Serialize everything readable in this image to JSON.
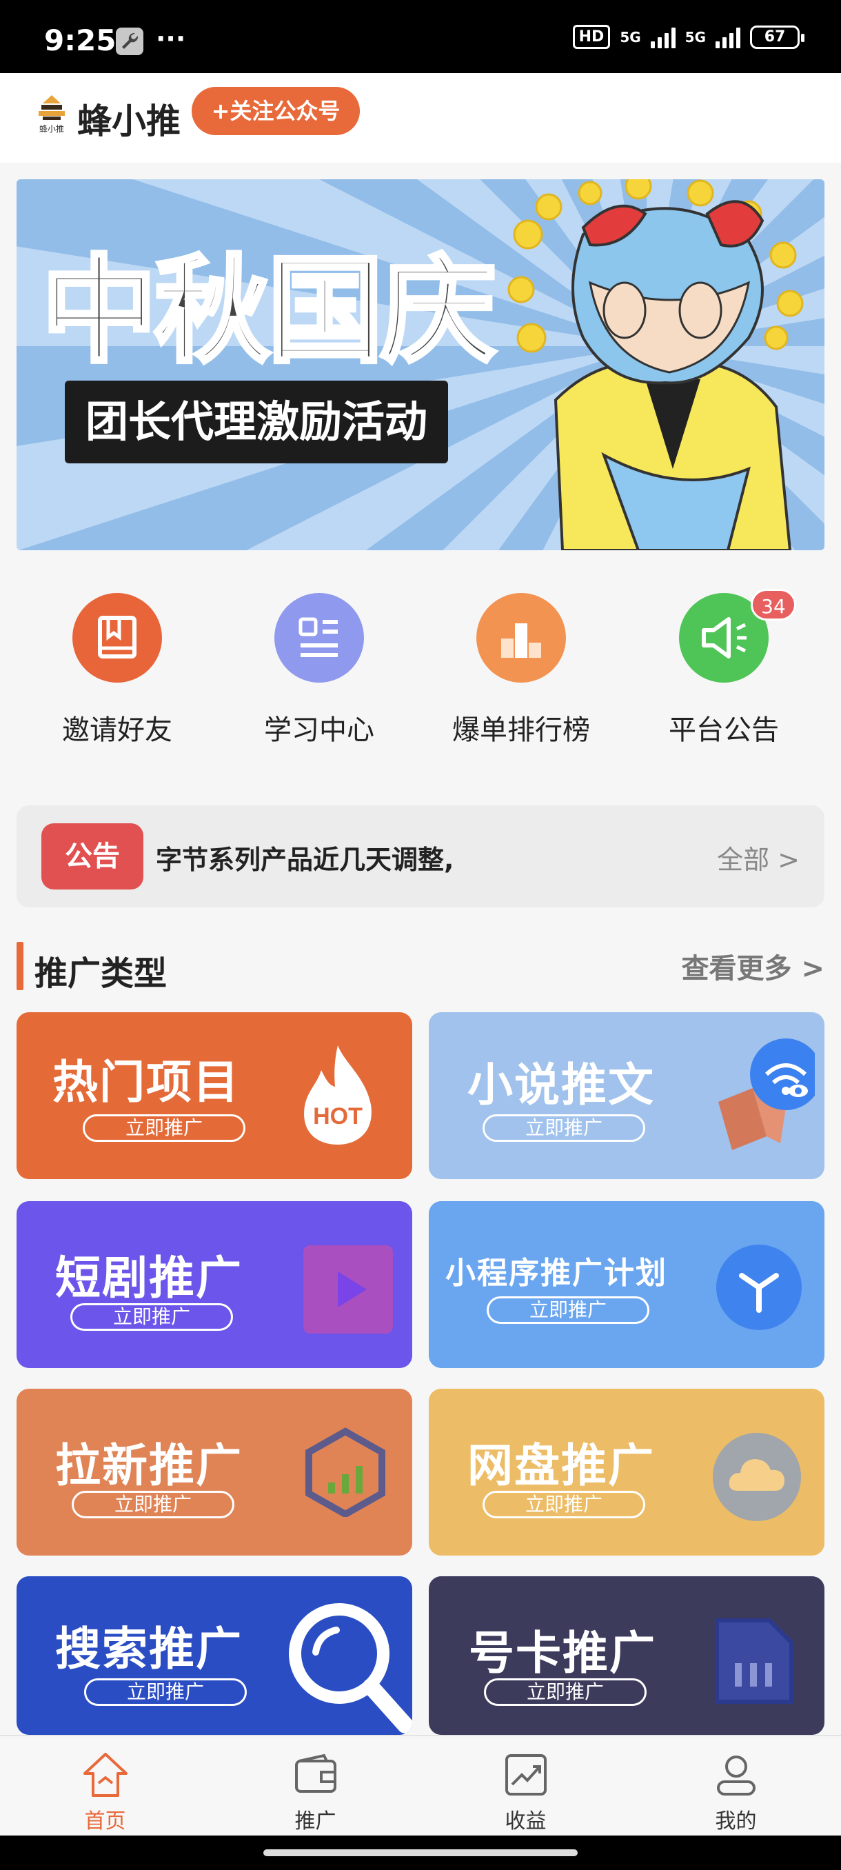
{
  "status_bar": {
    "time": "9:25",
    "dots": "···",
    "hd": "HD",
    "net1": "5G",
    "net2": "5G",
    "battery": "67"
  },
  "header": {
    "logo_small": "蜂小推",
    "app_name": "蜂小推",
    "follow_button": "+关注公众号"
  },
  "banner": {
    "title": "中秋国庆",
    "subtitle": "团长代理激励活动"
  },
  "quick_menu": [
    {
      "label": "邀请好友",
      "color": "#e8653a",
      "icon": "book-icon"
    },
    {
      "label": "学习中心",
      "color": "#8f99ee",
      "icon": "list-icon"
    },
    {
      "label": "爆单排行榜",
      "color": "#f39352",
      "icon": "podium-icon"
    },
    {
      "label": "平台公告",
      "color": "#4fc457",
      "icon": "megaphone-icon",
      "badge": "34"
    }
  ],
  "notice": {
    "tag": "公告",
    "text": "字节系列产品近几天调整,",
    "all": "全部 >"
  },
  "section": {
    "title": "推广类型",
    "more": "查看更多 >"
  },
  "cards": [
    {
      "title": "热门项目",
      "button": "立即推广",
      "color": "#e46a38",
      "icon": "hot-flame-icon",
      "icon_text": "HOT"
    },
    {
      "title": "小说推文",
      "button": "立即推广",
      "color": "#a0c2ec",
      "icon": "book-eye-icon"
    },
    {
      "title": "短剧推广",
      "button": "立即推广",
      "color": "#6c55ea",
      "icon": "play-icon"
    },
    {
      "title": "小程序推广计划",
      "button": "立即推广",
      "color": "#6aa6ef",
      "icon": "mini-program-icon"
    },
    {
      "title": "拉新推广",
      "button": "立即推广",
      "color": "#e08456",
      "icon": "hexagon-chart-icon"
    },
    {
      "title": "网盘推广",
      "button": "立即推广",
      "color": "#ecbc66",
      "icon": "cloud-icon"
    },
    {
      "title": "搜索推广",
      "button": "立即推广",
      "color": "#2a4dc4",
      "icon": "search-icon"
    },
    {
      "title": "号卡推广",
      "button": "立即推广",
      "color": "#3d3b5c",
      "icon": "sim-card-icon"
    }
  ],
  "bottom_nav": [
    {
      "label": "首页",
      "icon": "home-icon",
      "active": true
    },
    {
      "label": "推广",
      "icon": "wallet-icon",
      "active": false
    },
    {
      "label": "收益",
      "icon": "trend-icon",
      "active": false
    },
    {
      "label": "我的",
      "icon": "profile-icon",
      "active": false
    }
  ]
}
